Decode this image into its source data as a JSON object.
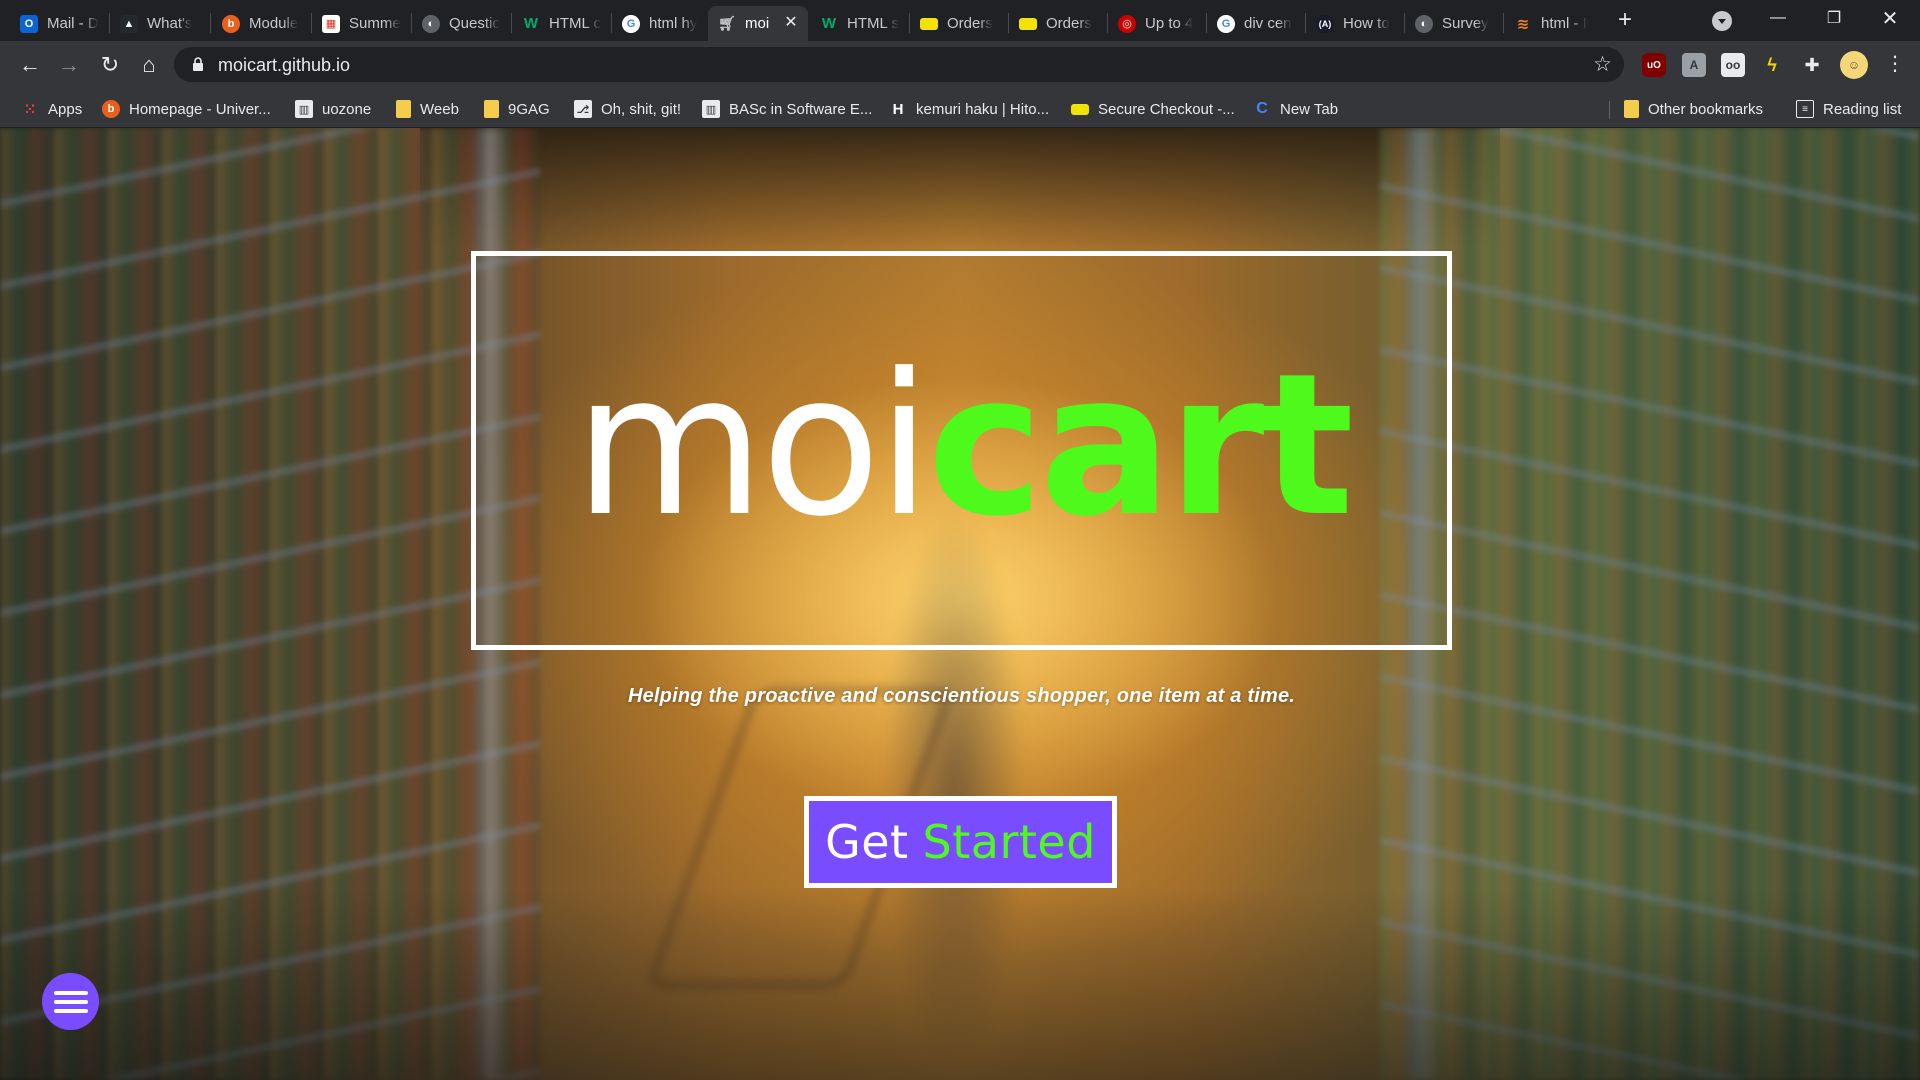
{
  "browser": {
    "tabs": [
      {
        "title": "Mail - D",
        "icon": "outlook-icon",
        "color": "#0a64d6"
      },
      {
        "title": "What's",
        "icon": "github-icon",
        "color": "#000000"
      },
      {
        "title": "Module",
        "icon": "brightspace-icon",
        "color": "#e8601c"
      },
      {
        "title": "Summe",
        "icon": "calendar-icon",
        "color": "#d93025"
      },
      {
        "title": "Questic",
        "icon": "globe-icon",
        "color": "#5f6368"
      },
      {
        "title": "HTML c",
        "icon": "w3schools-icon",
        "color": "#04aa6d"
      },
      {
        "title": "html hy",
        "icon": "google-icon",
        "color": "#ffffff"
      },
      {
        "title": "moi",
        "icon": "cart-icon",
        "color": "#9aa0a6"
      },
      {
        "title": "HTML s",
        "icon": "w3schools-icon",
        "color": "#04aa6d"
      },
      {
        "title": "Orders",
        "icon": "tag-icon",
        "color": "#f2e205"
      },
      {
        "title": "Orders",
        "icon": "tag-icon",
        "color": "#f2e205"
      },
      {
        "title": "Up to 4",
        "icon": "target-icon",
        "color": "#cc0000"
      },
      {
        "title": "div cen",
        "icon": "google-icon",
        "color": "#ffffff"
      },
      {
        "title": "How to",
        "icon": "code-icon",
        "color": "#1a1a2e"
      },
      {
        "title": "Survey",
        "icon": "globe-icon",
        "color": "#5f6368"
      },
      {
        "title": "html - I",
        "icon": "stackoverflow-icon",
        "color": "#f48024"
      }
    ],
    "active_tab_index": 7,
    "url": "moicart.github.io",
    "bookmarks": [
      {
        "label": "Apps",
        "icon": "apps-grid-icon"
      },
      {
        "label": "Homepage - Univer...",
        "icon": "brightspace-icon"
      },
      {
        "label": "uozone",
        "icon": "building-icon"
      },
      {
        "label": "Weeb",
        "icon": "folder-icon"
      },
      {
        "label": "9GAG",
        "icon": "folder-icon"
      },
      {
        "label": "Oh, shit, git!",
        "icon": "git-icon"
      },
      {
        "label": "BASc in Software E...",
        "icon": "building-icon"
      },
      {
        "label": "kemuri haku | Hito...",
        "icon": "h-icon"
      },
      {
        "label": "Secure Checkout -...",
        "icon": "tag-icon"
      },
      {
        "label": "New Tab",
        "icon": "chrome-icon"
      }
    ],
    "other_bookmarks": "Other bookmarks",
    "reading_list": "Reading list"
  },
  "page": {
    "logo_part1": "moi",
    "logo_part2": "cart",
    "tagline": "Helping the proactive and conscientious shopper, one item at a time.",
    "cta_word1": "Get",
    "cta_word2": "Started",
    "colors": {
      "accent_green": "#4dfa1b",
      "accent_purple": "#7a4cff",
      "frame": "#ffffff"
    }
  }
}
